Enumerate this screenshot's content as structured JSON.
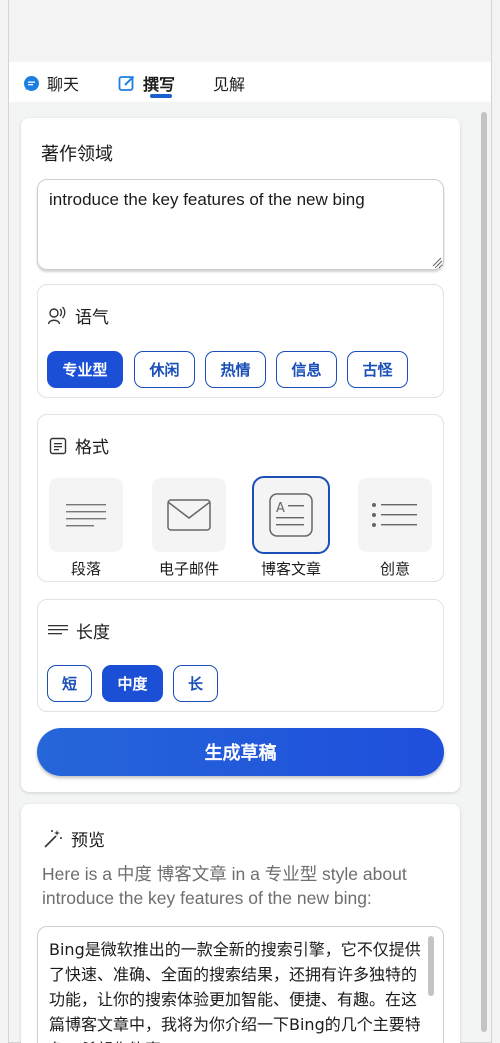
{
  "tabs": [
    {
      "label": "聊天",
      "icon": "chat-bubble-icon",
      "active": false
    },
    {
      "label": "撰写",
      "icon": "compose-icon",
      "active": true
    },
    {
      "label": "见解",
      "icon": "",
      "active": false
    }
  ],
  "topic": {
    "label": "著作领域",
    "value": "introduce the key features of the new bing"
  },
  "tone": {
    "label": "语气",
    "icon": "voice-icon",
    "options": [
      "专业型",
      "休闲",
      "热情",
      "信息",
      "古怪"
    ],
    "selected": "专业型"
  },
  "format": {
    "label": "格式",
    "icon": "format-icon",
    "options": [
      {
        "label": "段落",
        "icon": "paragraph-icon"
      },
      {
        "label": "电子邮件",
        "icon": "email-icon"
      },
      {
        "label": "博客文章",
        "icon": "blog-icon"
      },
      {
        "label": "创意",
        "icon": "ideas-icon"
      }
    ],
    "selected": "博客文章"
  },
  "length": {
    "label": "长度",
    "icon": "length-icon",
    "options": [
      "短",
      "中度",
      "长"
    ],
    "selected": "中度"
  },
  "generate_label": "生成草稿",
  "preview": {
    "label": "预览",
    "icon": "magic-wand-icon",
    "description": "Here is a 中度 博客文章 in a 专业型 style about introduce the key features of the new bing:",
    "output": "Bing是微软推出的一款全新的搜索引擎，它不仅提供了快速、准确、全面的搜索结果，还拥有许多独特的功能，让你的搜索体验更加智能、便捷、有趣。在这篇博客文章中，我将为你介绍一下Bing的几个主要特色，希望你能喜"
  },
  "colors": {
    "accent": "#1a4fd6",
    "accent_border": "#1a4fb8",
    "panel_bg": "#ffffff",
    "page_bg": "#f3f3f3"
  }
}
